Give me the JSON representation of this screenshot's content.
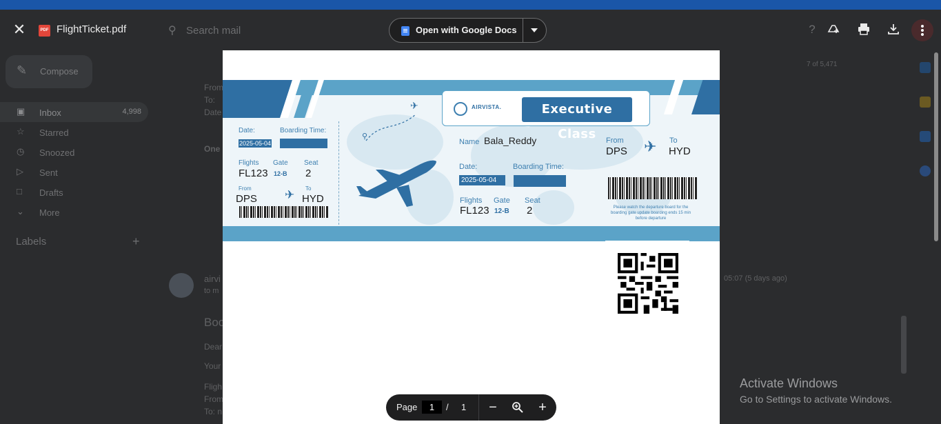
{
  "viewer": {
    "file_name": "FlightTicket.pdf",
    "file_type_badge": "PDF",
    "open_with_label": "Open with Google Docs",
    "page_label": "Page",
    "current_page": "1",
    "page_separator": "/",
    "total_pages": "1"
  },
  "gmail_background": {
    "search_placeholder": "Search mail",
    "compose_label": "Compose",
    "nav": [
      {
        "label": "Inbox",
        "count": "4,998",
        "icon": "inbox-icon"
      },
      {
        "label": "Starred",
        "count": "",
        "icon": "star-icon"
      },
      {
        "label": "Snoozed",
        "count": "",
        "icon": "clock-icon"
      },
      {
        "label": "Sent",
        "count": "",
        "icon": "send-icon"
      },
      {
        "label": "Drafts",
        "count": "",
        "icon": "draft-icon"
      },
      {
        "label": "More",
        "count": "",
        "icon": "chevron-down-icon"
      }
    ],
    "labels_heading": "Labels",
    "mail_lines": [
      "From",
      "To: ",
      "Date",
      "One",
      "airvi",
      "to m",
      "Boo",
      "Dear",
      "Your",
      "Fligh",
      "From",
      "To: n"
    ],
    "pager_text": "7 of 5,471",
    "timestamp_text": "05:07 (5 days ago)"
  },
  "ticket": {
    "brand": "AIRVISTA.",
    "class_label": "Executive Class",
    "stub": {
      "date_label": "Date:",
      "date_value": "2025-05-04",
      "boarding_label": "Boarding Time:",
      "flights_label": "Flights",
      "flights_value": "FL123",
      "gate_label": "Gate",
      "gate_value": "12-B",
      "seat_label": "Seat",
      "seat_value": "2",
      "from_label": "From",
      "from_value": "DPS",
      "to_label": "To",
      "to_value": "HYD"
    },
    "main": {
      "name_label": "Name",
      "name_value": "Bala_Reddy",
      "date_label": "Date:",
      "date_value": "2025-05-04",
      "boarding_label": "Boarding Time:",
      "flights_label": "Flights",
      "flights_value": "FL123",
      "gate_label": "Gate",
      "gate_value": "12-B",
      "seat_label": "Seat",
      "seat_value": "2",
      "from_label": "From",
      "from_value": "DPS",
      "to_label": "To",
      "to_value": "HYD",
      "notice": "Please watch the departure board for the boarding gate update boarding ends 15 min before departure"
    }
  },
  "watermark": {
    "title": "Activate Windows",
    "subtitle": "Go to Settings to activate Windows."
  },
  "colors": {
    "ticket_blue": "#2f6fa3",
    "ticket_light_blue": "#5ba3c8",
    "os_blue": "#1a56a8",
    "pdf_red": "#e2463a"
  }
}
